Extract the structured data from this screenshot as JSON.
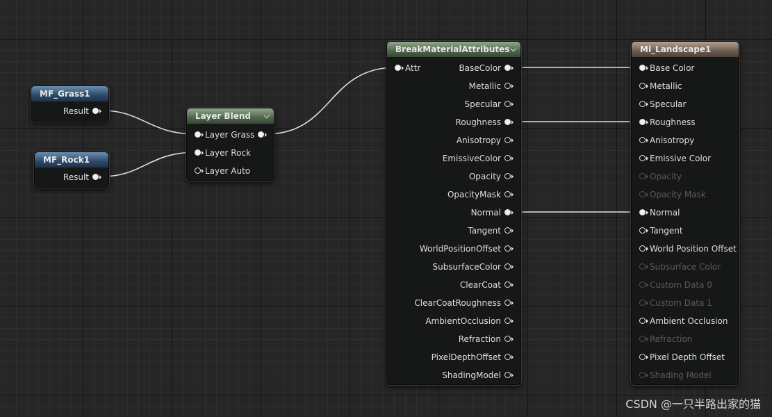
{
  "nodes": {
    "mf_grass": {
      "title": "MF_Grass1",
      "result_label": "Result"
    },
    "mf_rock": {
      "title": "MF_Rock1",
      "result_label": "Result"
    },
    "layer_blend": {
      "title": "Layer Blend",
      "in_grass": "Layer Grass",
      "in_rock": "Layer Rock",
      "in_auto": "Layer Auto"
    },
    "break_material": {
      "title": "BreakMaterialAttributes",
      "input": "Attr",
      "outputs": [
        "BaseColor",
        "Metallic",
        "Specular",
        "Roughness",
        "Anisotropy",
        "EmissiveColor",
        "Opacity",
        "OpacityMask",
        "Normal",
        "Tangent",
        "WorldPositionOffset",
        "SubsurfaceColor",
        "ClearCoat",
        "ClearCoatRoughness",
        "AmbientOcclusion",
        "Refraction",
        "PixelDepthOffset",
        "ShadingModel"
      ]
    },
    "mi_landscape": {
      "title": "Mi_Landscape1",
      "inputs": [
        "Base Color",
        "Metallic",
        "Specular",
        "Roughness",
        "Anisotropy",
        "Emissive Color",
        "Opacity",
        "Opacity Mask",
        "Normal",
        "Tangent",
        "World Position Offset",
        "Subsurface Color",
        "Custom Data 0",
        "Custom Data 1",
        "Ambient Occlusion",
        "Refraction",
        "Pixel Depth Offset",
        "Shading Model"
      ],
      "disabled": [
        "Opacity",
        "Opacity Mask",
        "Subsurface Color",
        "Custom Data 0",
        "Custom Data 1",
        "Refraction",
        "Shading Model"
      ]
    }
  },
  "connected": [
    "BaseColor",
    "Roughness",
    "Normal"
  ],
  "watermark": "CSDN @一只半路出家的猫",
  "icons": {
    "collapse": "chevron-down-icon",
    "pin": "pin-circle-icon"
  }
}
